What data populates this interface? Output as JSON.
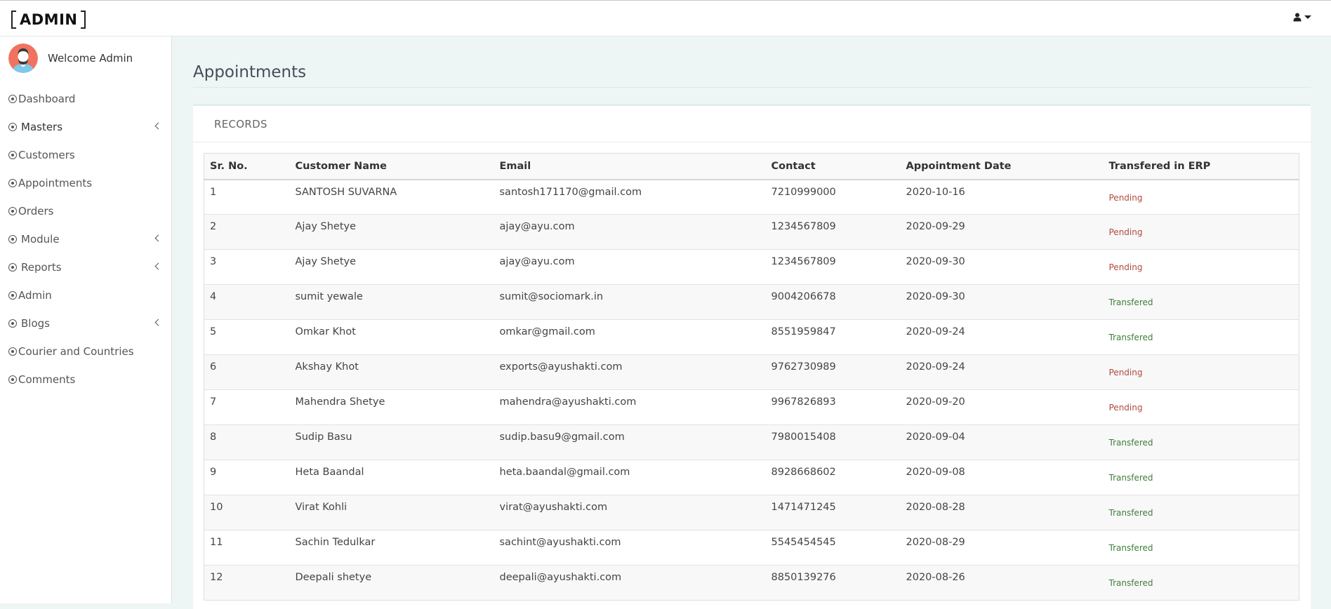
{
  "brand": {
    "name": "ADMIN"
  },
  "header": {
    "user_icon": "user-icon"
  },
  "sidebar": {
    "welcome": "Welcome Admin",
    "items": [
      {
        "label": "Dashboard",
        "has_submenu": false
      },
      {
        "label": "Masters",
        "has_submenu": true
      },
      {
        "label": "Customers",
        "has_submenu": false
      },
      {
        "label": "Appointments",
        "has_submenu": false
      },
      {
        "label": "Orders",
        "has_submenu": false
      },
      {
        "label": "Module",
        "has_submenu": true
      },
      {
        "label": "Reports",
        "has_submenu": true
      },
      {
        "label": "Admin",
        "has_submenu": false
      },
      {
        "label": "Blogs",
        "has_submenu": true
      },
      {
        "label": "Courier and Countries",
        "has_submenu": false
      },
      {
        "label": "Comments",
        "has_submenu": false
      }
    ]
  },
  "main": {
    "title": "Appointments",
    "panel_heading": "RECORDS",
    "columns": [
      "Sr. No.",
      "Customer Name",
      "Email",
      "Contact",
      "Appointment Date",
      "Transfered in ERP"
    ],
    "rows": [
      {
        "sr": "1",
        "name": "SANTOSH SUVARNA",
        "email": "santosh171170@gmail.com",
        "contact": "7210999000",
        "date": "2020-10-16",
        "status": "Pending"
      },
      {
        "sr": "2",
        "name": "Ajay Shetye",
        "email": "ajay@ayu.com",
        "contact": "1234567809",
        "date": "2020-09-29",
        "status": "Pending"
      },
      {
        "sr": "3",
        "name": "Ajay Shetye",
        "email": "ajay@ayu.com",
        "contact": "1234567809",
        "date": "2020-09-30",
        "status": "Pending"
      },
      {
        "sr": "4",
        "name": "sumit yewale",
        "email": "sumit@sociomark.in",
        "contact": "9004206678",
        "date": "2020-09-30",
        "status": "Transfered"
      },
      {
        "sr": "5",
        "name": "Omkar Khot",
        "email": "omkar@gmail.com",
        "contact": "8551959847",
        "date": "2020-09-24",
        "status": "Transfered"
      },
      {
        "sr": "6",
        "name": "Akshay Khot",
        "email": "exports@ayushakti.com",
        "contact": "9762730989",
        "date": "2020-09-24",
        "status": "Pending"
      },
      {
        "sr": "7",
        "name": "Mahendra Shetye",
        "email": "mahendra@ayushakti.com",
        "contact": "9967826893",
        "date": "2020-09-20",
        "status": "Pending"
      },
      {
        "sr": "8",
        "name": "Sudip Basu",
        "email": "sudip.basu9@gmail.com",
        "contact": "7980015408",
        "date": "2020-09-04",
        "status": "Transfered"
      },
      {
        "sr": "9",
        "name": "Heta Baandal",
        "email": "heta.baandal@gmail.com",
        "contact": "8928668602",
        "date": "2020-09-08",
        "status": "Transfered"
      },
      {
        "sr": "10",
        "name": "Virat Kohli",
        "email": "virat@ayushakti.com",
        "contact": "1471471245",
        "date": "2020-08-28",
        "status": "Transfered"
      },
      {
        "sr": "11",
        "name": "Sachin Tedulkar",
        "email": "sachint@ayushakti.com",
        "contact": "5545454545",
        "date": "2020-08-29",
        "status": "Transfered"
      },
      {
        "sr": "12",
        "name": "Deepali shetye",
        "email": "deepali@ayushakti.com",
        "contact": "8850139276",
        "date": "2020-08-26",
        "status": "Transfered"
      }
    ]
  },
  "colors": {
    "pending": "#b14a3e",
    "transfered": "#3f7d3a",
    "page_bg": "#eef6f5"
  }
}
